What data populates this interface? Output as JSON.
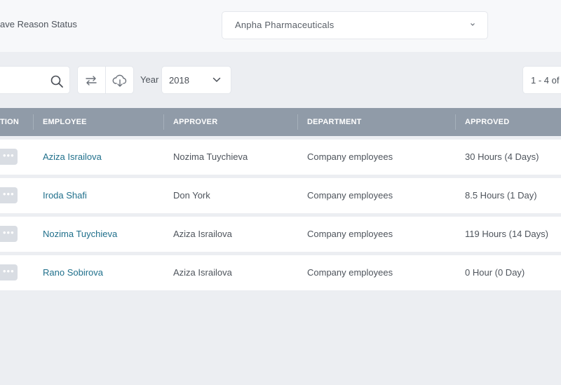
{
  "header": {
    "title": "ave Reason Status",
    "company_select": {
      "value": "Anpha Pharmaceuticals",
      "icon": "chevron-down-icon"
    }
  },
  "toolbar": {
    "search": {
      "placeholder": "",
      "icon": "search-icon"
    },
    "swap_icon": "swap-arrows-icon",
    "download_icon": "cloud-download-icon",
    "year_label": "Year",
    "year_value": "2018",
    "pagination_text": "1 - 4 of"
  },
  "table": {
    "columns": [
      "TION",
      "EMPLOYEE",
      "APPROVER",
      "DEPARTMENT",
      "APPROVED"
    ],
    "rows": [
      {
        "actions": "•••",
        "employee": "Aziza Israilova",
        "approver": "Nozima Tuychieva",
        "department": "Company employees",
        "approved": "30 Hours (4 Days)"
      },
      {
        "actions": "•••",
        "employee": "Iroda Shafi",
        "approver": "Don York",
        "department": "Company employees",
        "approved": "8.5 Hours (1 Day)"
      },
      {
        "actions": "•••",
        "employee": "Nozima Tuychieva",
        "approver": "Aziza Israilova",
        "department": "Company employees",
        "approved": "119 Hours (14 Days)"
      },
      {
        "actions": "•••",
        "employee": "Rano Sobirova",
        "approver": "Aziza Israilova",
        "department": "Company employees",
        "approved": "0 Hour (0 Day)"
      }
    ]
  },
  "colors": {
    "header_bg": "#909ba8",
    "link": "#1f6f8b",
    "page_bg": "#eceef2"
  }
}
